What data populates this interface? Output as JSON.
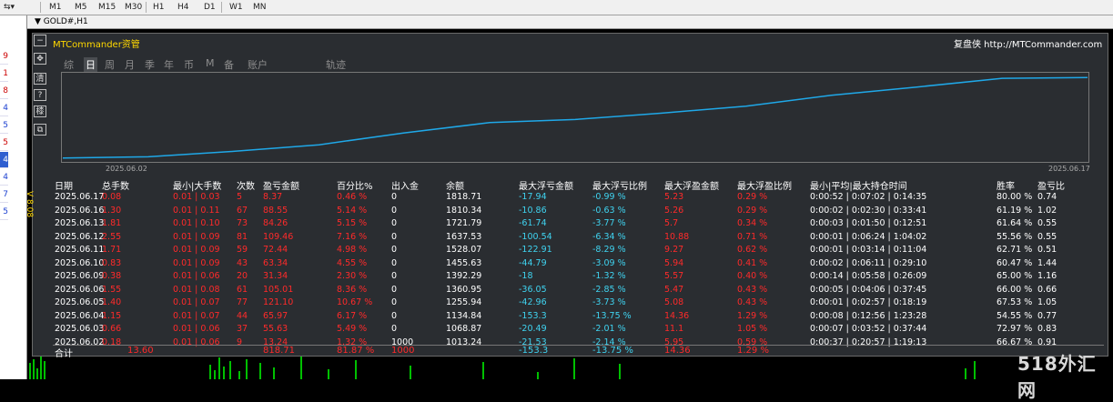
{
  "timeframes": [
    "M1",
    "M5",
    "M15",
    "M30",
    "H1",
    "H4",
    "D1",
    "W1",
    "MN"
  ],
  "chart_tab": "GOLD#,H1",
  "left_panel_values": [
    "9",
    "1",
    "8",
    "4",
    "5",
    "5",
    "4",
    "4",
    "7",
    "5"
  ],
  "left_panel_colors": [
    "#cc0000",
    "#cc0000",
    "#cc0000",
    "#1a3fd0",
    "#1a3fd0",
    "#cc0000",
    "#cc0000",
    "#1a3fd0",
    "#1a3fd0",
    "#1a3fd0"
  ],
  "tool_icons": [
    "minus-icon",
    "move-icon",
    "clear-icon",
    "help-icon",
    "layout-icon",
    "window-icon"
  ],
  "tool_glyphs": [
    "−",
    "✥",
    "清",
    "?",
    "㯃",
    "⧉"
  ],
  "brand": "MTCommander资管",
  "replay": "复盘侠 http://MTCommander.com",
  "tabs": [
    "综",
    "日",
    "周",
    "月",
    "季",
    "年",
    "币",
    "M",
    "备",
    "账户",
    "轨迹"
  ],
  "active_tab": "日",
  "equity_chart": {
    "start_date": "2025.06.02",
    "end_date": "2025.06.17",
    "line_color": "#1fa8e8"
  },
  "version": "V 8.08",
  "table": {
    "headers": [
      "日期",
      "总手数",
      "最小|大手数",
      "次数",
      "盈亏金额",
      "百分比%",
      "出入金",
      "余额",
      "最大浮亏金额",
      "最大浮亏比例",
      "最大浮盈金额",
      "最大浮盈比例",
      "最小|平均|最大持仓时间",
      "胜率",
      "盈亏比"
    ],
    "rows": [
      [
        "2025.06.17",
        "0.08",
        "0.01 | 0.03",
        "5",
        "8.37",
        "0.46 %",
        "0",
        "1818.71",
        "-17.94",
        "-0.99 %",
        "5.23",
        "0.29 %",
        "0:00:52 | 0:07:02 | 0:14:35",
        "80.00 %",
        "0.74"
      ],
      [
        "2025.06.16",
        "1.30",
        "0.01 | 0.11",
        "67",
        "88.55",
        "5.14 %",
        "0",
        "1810.34",
        "-10.86",
        "-0.63 %",
        "5.26",
        "0.29 %",
        "0:00:02 | 0:02:30 | 0:33:41",
        "61.19 %",
        "1.02"
      ],
      [
        "2025.06.13",
        "1.81",
        "0.01 | 0.10",
        "73",
        "84.26",
        "5.15 %",
        "0",
        "1721.79",
        "-61.74",
        "-3.77 %",
        "5.7",
        "0.34 %",
        "0:00:03 | 0:01:50 | 0:12:51",
        "61.64 %",
        "0.55"
      ],
      [
        "2025.06.12",
        "2.55",
        "0.01 | 0.09",
        "81",
        "109.46",
        "7.16 %",
        "0",
        "1637.53",
        "-100.54",
        "-6.34 %",
        "10.88",
        "0.71 %",
        "0:00:01 | 0:06:24 | 1:04:02",
        "55.56 %",
        "0.55"
      ],
      [
        "2025.06.11",
        "1.71",
        "0.01 | 0.09",
        "59",
        "72.44",
        "4.98 %",
        "0",
        "1528.07",
        "-122.91",
        "-8.29 %",
        "9.27",
        "0.62 %",
        "0:00:01 | 0:03:14 | 0:11:04",
        "62.71 %",
        "0.51"
      ],
      [
        "2025.06.10",
        "0.83",
        "0.01 | 0.09",
        "43",
        "63.34",
        "4.55 %",
        "0",
        "1455.63",
        "-44.79",
        "-3.09 %",
        "5.94",
        "0.41 %",
        "0:00:02 | 0:06:11 | 0:29:10",
        "60.47 %",
        "1.44"
      ],
      [
        "2025.06.09",
        "0.38",
        "0.01 | 0.06",
        "20",
        "31.34",
        "2.30 %",
        "0",
        "1392.29",
        "-18",
        "-1.32 %",
        "5.57",
        "0.40 %",
        "0:00:14 | 0:05:58 | 0:26:09",
        "65.00 %",
        "1.16"
      ],
      [
        "2025.06.06",
        "1.55",
        "0.01 | 0.08",
        "61",
        "105.01",
        "8.36 %",
        "0",
        "1360.95",
        "-36.05",
        "-2.85 %",
        "5.47",
        "0.43 %",
        "0:00:05 | 0:04:06 | 0:37:45",
        "66.00 %",
        "0.66"
      ],
      [
        "2025.06.05",
        "1.40",
        "0.01 | 0.07",
        "77",
        "121.10",
        "10.67 %",
        "0",
        "1255.94",
        "-42.96",
        "-3.73 %",
        "5.08",
        "0.43 %",
        "0:00:01 | 0:02:57 | 0:18:19",
        "67.53 %",
        "1.05"
      ],
      [
        "2025.06.04",
        "1.15",
        "0.01 | 0.07",
        "44",
        "65.97",
        "6.17 %",
        "0",
        "1134.84",
        "-153.3",
        "-13.75 %",
        "14.36",
        "1.29 %",
        "0:00:08 | 0:12:56 | 1:23:28",
        "54.55 %",
        "0.77"
      ],
      [
        "2025.06.03",
        "0.66",
        "0.01 | 0.06",
        "37",
        "55.63",
        "5.49 %",
        "0",
        "1068.87",
        "-20.49",
        "-2.01 %",
        "11.1",
        "1.05 %",
        "0:00:07 | 0:03:52 | 0:37:44",
        "72.97 %",
        "0.83"
      ],
      [
        "2025.06.02",
        "0.18",
        "0.01 | 0.06",
        "9",
        "13.24",
        "1.32 %",
        "1000",
        "1013.24",
        "-21.53",
        "-2.14 %",
        "5.95",
        "0.59 %",
        "0:00:37 | 0:20:57 | 1:19:13",
        "66.67 %",
        "0.91"
      ]
    ],
    "total": [
      "合计",
      "13.60",
      "",
      "",
      "818.71",
      "81.87 %",
      "1000",
      "",
      "-153.3",
      "-13.75 %",
      "14.36",
      "1.29 %",
      "",
      "",
      ""
    ]
  },
  "colors": {
    "panel_bg": "#2a2d31",
    "red": "#ff2a2a",
    "cyan": "#3fd3f0",
    "brand_yellow": "#ffd800",
    "volume_green": "#00c000"
  },
  "watermark": "518外汇网"
}
